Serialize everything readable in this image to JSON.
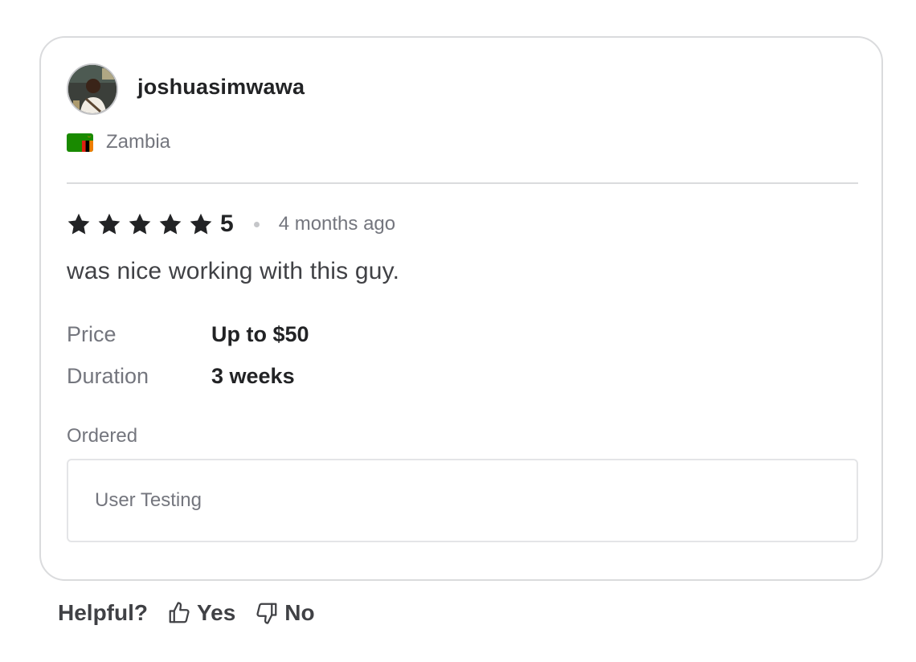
{
  "review": {
    "username": "joshuasimwawa",
    "country": "Zambia",
    "rating": "5",
    "stars": 5,
    "time_ago": "4 months ago",
    "text": "was nice working with this guy.",
    "details": [
      {
        "label": "Price",
        "value": "Up to $50"
      },
      {
        "label": "Duration",
        "value": "3 weeks"
      }
    ],
    "ordered_label": "Ordered",
    "ordered_item": "User Testing"
  },
  "feedback": {
    "question": "Helpful?",
    "yes_label": "Yes",
    "no_label": "No"
  },
  "colors": {
    "star": "#222325",
    "border": "#dadbdd",
    "muted_text": "#74767e",
    "flag_green": "#198a00"
  },
  "icons": {
    "avatar": "user-avatar-photo",
    "flag": "zambia-flag-icon",
    "star": "star-icon",
    "yes": "thumbs-up-icon",
    "no": "thumbs-down-icon"
  }
}
